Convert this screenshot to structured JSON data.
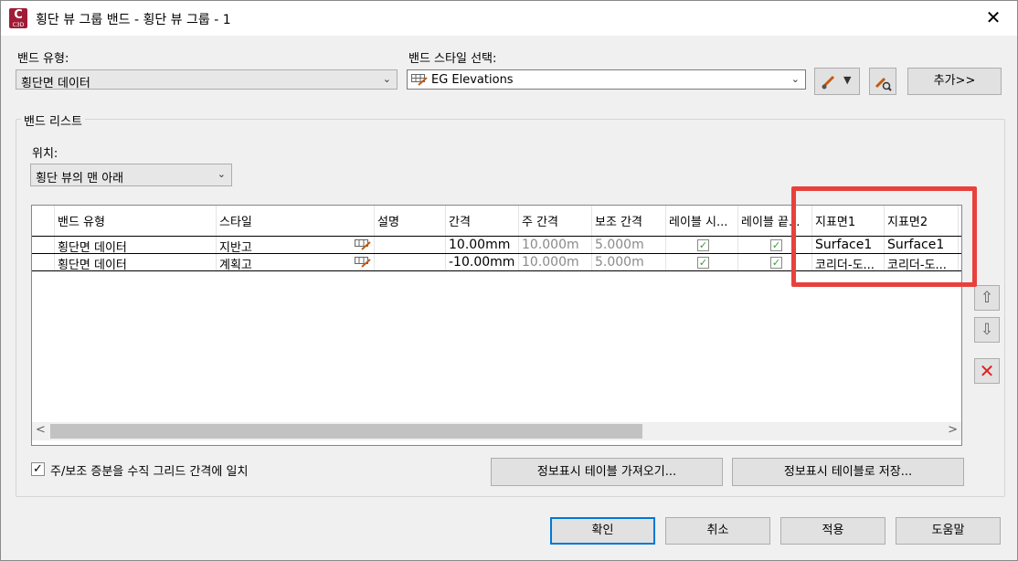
{
  "window": {
    "title": "횡단 뷰 그룹 밴드 - 횡단 뷰 그룹 - 1",
    "app_icon_letter": "C",
    "app_icon_sub": "C3D"
  },
  "band_type": {
    "label": "밴드 유형:",
    "value": "횡단면 데이터"
  },
  "band_style": {
    "label": "밴드 스타일 선택:",
    "value": "EG Elevations"
  },
  "add_button": "추가>>",
  "band_list": {
    "title": "밴드 리스트",
    "location_label": "위치:",
    "location_value": "횡단 뷰의 맨 아래",
    "columns": [
      "밴드 유형",
      "스타일",
      "설명",
      "간격",
      "주 간격",
      "보조 간격",
      "레이블 시...",
      "레이블 끝...",
      "지표면1",
      "지표면2"
    ],
    "rows": [
      {
        "band_type": "횡단면 데이터",
        "style": "지반고",
        "description": "",
        "gap": "10.00mm",
        "major": "10.000m",
        "minor": "5.000m",
        "label_start": true,
        "label_end": true,
        "surface1": "Surface1",
        "surface2": "Surface1"
      },
      {
        "band_type": "횡단면 데이터",
        "style": "계획고",
        "description": "",
        "gap": "-10.00mm",
        "major": "10.000m",
        "minor": "5.000m",
        "label_start": true,
        "label_end": true,
        "surface1": "코리더-도...",
        "surface2": "코리더-도..."
      }
    ]
  },
  "match_grid_checkbox": {
    "label": "주/보조 증분을 수직 그리드 간격에 일치",
    "checked": true
  },
  "import_button": "정보표시 테이블 가져오기...",
  "save_button": "정보표시 테이블로 저장...",
  "footer": {
    "ok": "확인",
    "cancel": "취소",
    "apply": "적용",
    "help": "도움말"
  },
  "colors": {
    "highlight": "#e8413c",
    "accent": "#0078d7",
    "app_icon": "#a01c36",
    "check": "#2e9e2e"
  }
}
